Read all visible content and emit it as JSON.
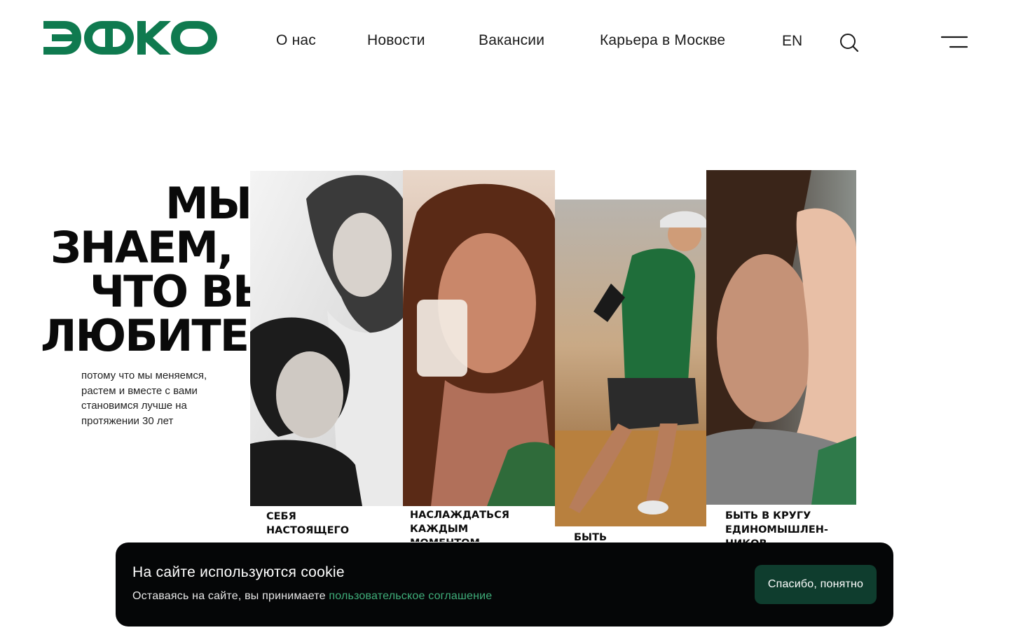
{
  "brand": {
    "name": "ЭФКО",
    "color": "#0f7a4f"
  },
  "nav": {
    "items": [
      {
        "label": "О нас"
      },
      {
        "label": "Новости"
      },
      {
        "label": "Вакансии"
      },
      {
        "label": "Карьера в Москве"
      }
    ],
    "lang": "EN",
    "search_icon": "search-icon",
    "menu_icon": "menu-icon"
  },
  "hero": {
    "title_lines": [
      "МЫ",
      "ЗНАЕМ,",
      "ЧТО ВЫ",
      "ЛЮБИТЕ,"
    ],
    "subtitle": "потому что мы меняемся, растем и вместе с вами становимся лучше на протяжении 30 лет"
  },
  "panels": [
    {
      "caption": "СЕБЯ\nНАСТОЯЩЕГО"
    },
    {
      "caption": "НАСЛАЖДАТЬСЯ\nКАЖДЫМ\nМОМЕНТОМ"
    },
    {
      "caption": "БЫТЬ"
    },
    {
      "caption": "БЫТЬ В КРУГУ\nЕДИНОМЫШЛЕН-\nНИКОВ"
    }
  ],
  "cookie": {
    "title": "На сайте используются cookie",
    "text": "Оставаясь на сайте, вы принимаете ",
    "link": "пользовательское соглашение",
    "button": "Спасибо, понятно"
  },
  "colors": {
    "accent": "#0f7a4f",
    "link": "#3fae7a",
    "banner_bg": "#050607",
    "button_bg": "#0f3d2e"
  }
}
